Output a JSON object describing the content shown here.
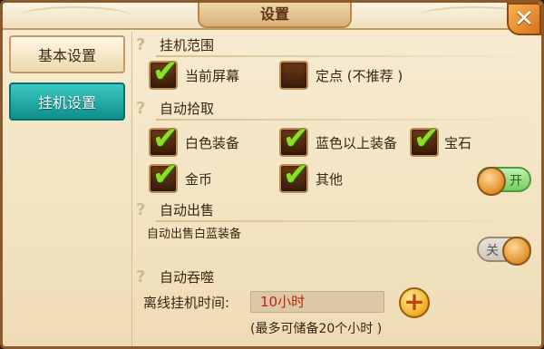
{
  "window": {
    "title": "设置",
    "close_glyph": "✕"
  },
  "nav": {
    "items": [
      {
        "label": "基本设置",
        "active": false
      },
      {
        "label": "挂机设置",
        "active": true
      }
    ]
  },
  "sections": {
    "range": {
      "header": "挂机范围",
      "options": [
        {
          "label": "当前屏幕",
          "checked": true
        },
        {
          "label": "定点 (不推荐 )",
          "checked": false
        }
      ]
    },
    "pickup": {
      "header": "自动拾取",
      "options": [
        {
          "label": "白色装备",
          "checked": true
        },
        {
          "label": "蓝色以上装备",
          "checked": true
        },
        {
          "label": "宝石",
          "checked": true
        },
        {
          "label": "金币",
          "checked": true
        },
        {
          "label": "其他",
          "checked": true
        }
      ],
      "toggle": {
        "label": "开",
        "on": true
      }
    },
    "sell": {
      "header": "自动出售",
      "description": "自动出售白蓝装备",
      "toggle": {
        "label": "关",
        "on": false
      }
    },
    "devour": {
      "header": "自动吞噬"
    }
  },
  "offline": {
    "label": "离线挂机时间:",
    "value": "10小时",
    "hint": "(最多可储备20个小时 )",
    "plus_glyph": "+"
  },
  "colors": {
    "accent_teal": "#0d8f8c",
    "check_green": "#8fdc2a",
    "value_red": "#c41e0c"
  }
}
